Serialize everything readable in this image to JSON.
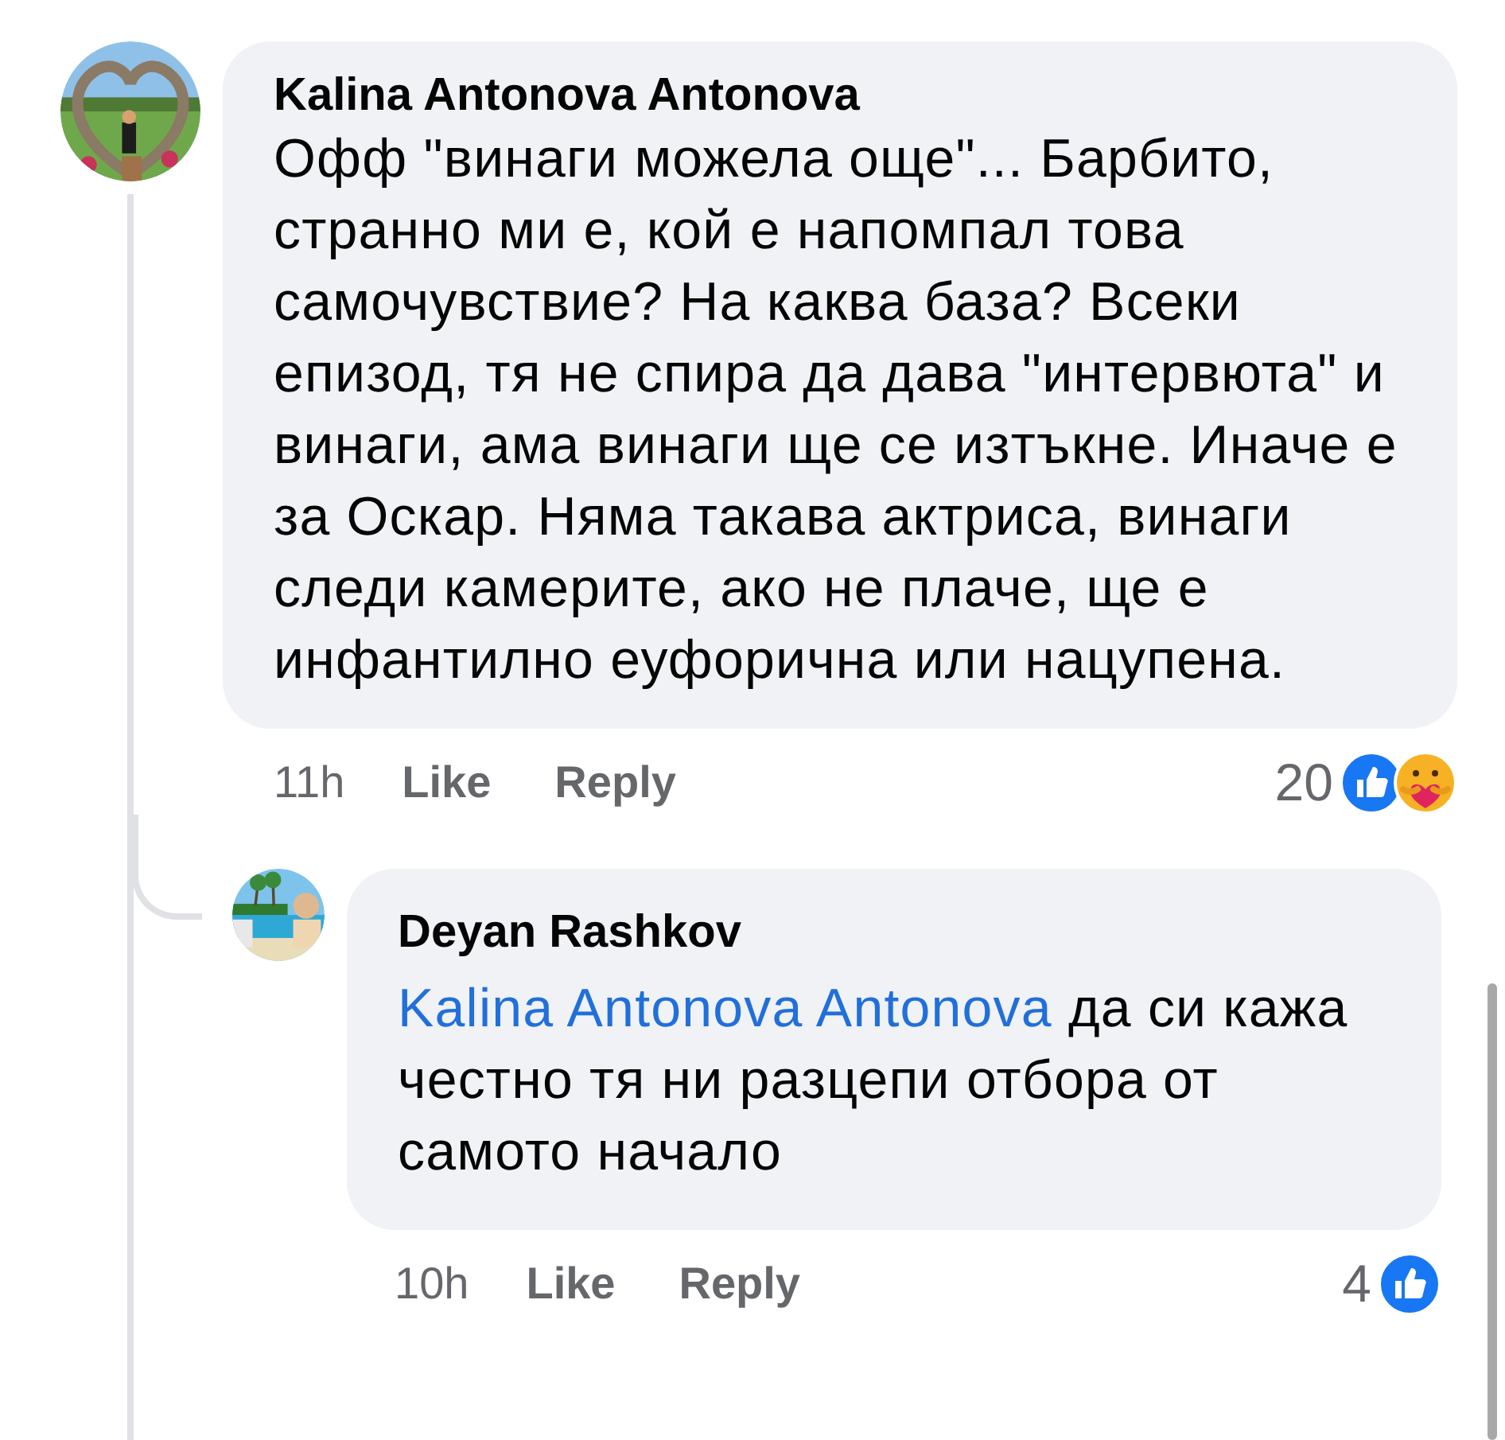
{
  "comments": [
    {
      "author": "Kalina Antonova Antonova",
      "avatar": {
        "kind": "picture"
      },
      "text": "Офф \"винаги можела още\"... Барбито, странно ми е, кой е напомпал това самочувствие? На каква база? Всеки епизод, тя не спира да дава \"интервюта\" и винаги, ама винаги ще се изтъкне. Иначе е за Оскар. Няма такава актриса, винаги следи камерите, ако не плаче, ще е инфантилно еуфорична или нацупена.",
      "time": "11h",
      "actions": [
        "Like",
        "Reply"
      ],
      "reaction_count": "20",
      "reactions": [
        {
          "kind": "like"
        },
        {
          "kind": "care"
        }
      ],
      "replies": [
        {
          "author": "Deyan Rashkov",
          "avatar": {
            "kind": "picture"
          },
          "mention": "Kalina Antonova Antonova",
          "text": "да си кажа честно тя ни разцепи отбора от самото начало",
          "time": "10h",
          "actions": [
            "Like",
            "Reply"
          ],
          "reaction_count": "4",
          "reactions": [
            {
              "kind": "like"
            }
          ]
        }
      ]
    }
  ]
}
